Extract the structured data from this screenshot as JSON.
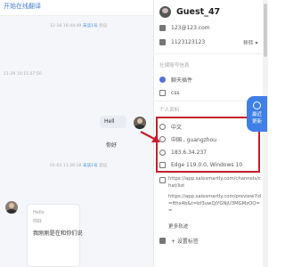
{
  "chat": {
    "top_link": "开始在线翻译",
    "messages": [
      {
        "time": "12-18 16:44:49",
        "status": "未读1号",
        "extra": "您议"
      },
      {
        "time": "11-29 10:15 07:50"
      },
      {
        "time": "01-03 11:26:18",
        "status": "未读1号",
        "extra": "您议",
        "bubble1": "Hell",
        "bubble2": "你好"
      }
    ],
    "quote": {
      "line1": "Hello",
      "line2": "你好",
      "line3": "我刚刚是在和你们说"
    }
  },
  "sidebar": {
    "guest_name": "Guest_47",
    "email": "123@123.com",
    "phone": "1123123123",
    "transfer_label": "移转",
    "section_title": "社媒账号信息",
    "social": "聊天插件",
    "social_sub": "css",
    "personal_title": "个人资料",
    "language": "中文",
    "location": "中国 , guangzhou",
    "ip": "183.6.34.237",
    "browser": "Edge 119.0.0, Windows 10",
    "url1": "https://app.salesmartly.com/channels/chat/list",
    "url2": "https://app.salesmartly.com/preview?id=fthx4b&t=bf3uwQjYGNjU3MGMzOQ==",
    "more_label": "更多轨迹",
    "tag_label": "+ 设置标签",
    "float_btn": "最近\n更新"
  }
}
